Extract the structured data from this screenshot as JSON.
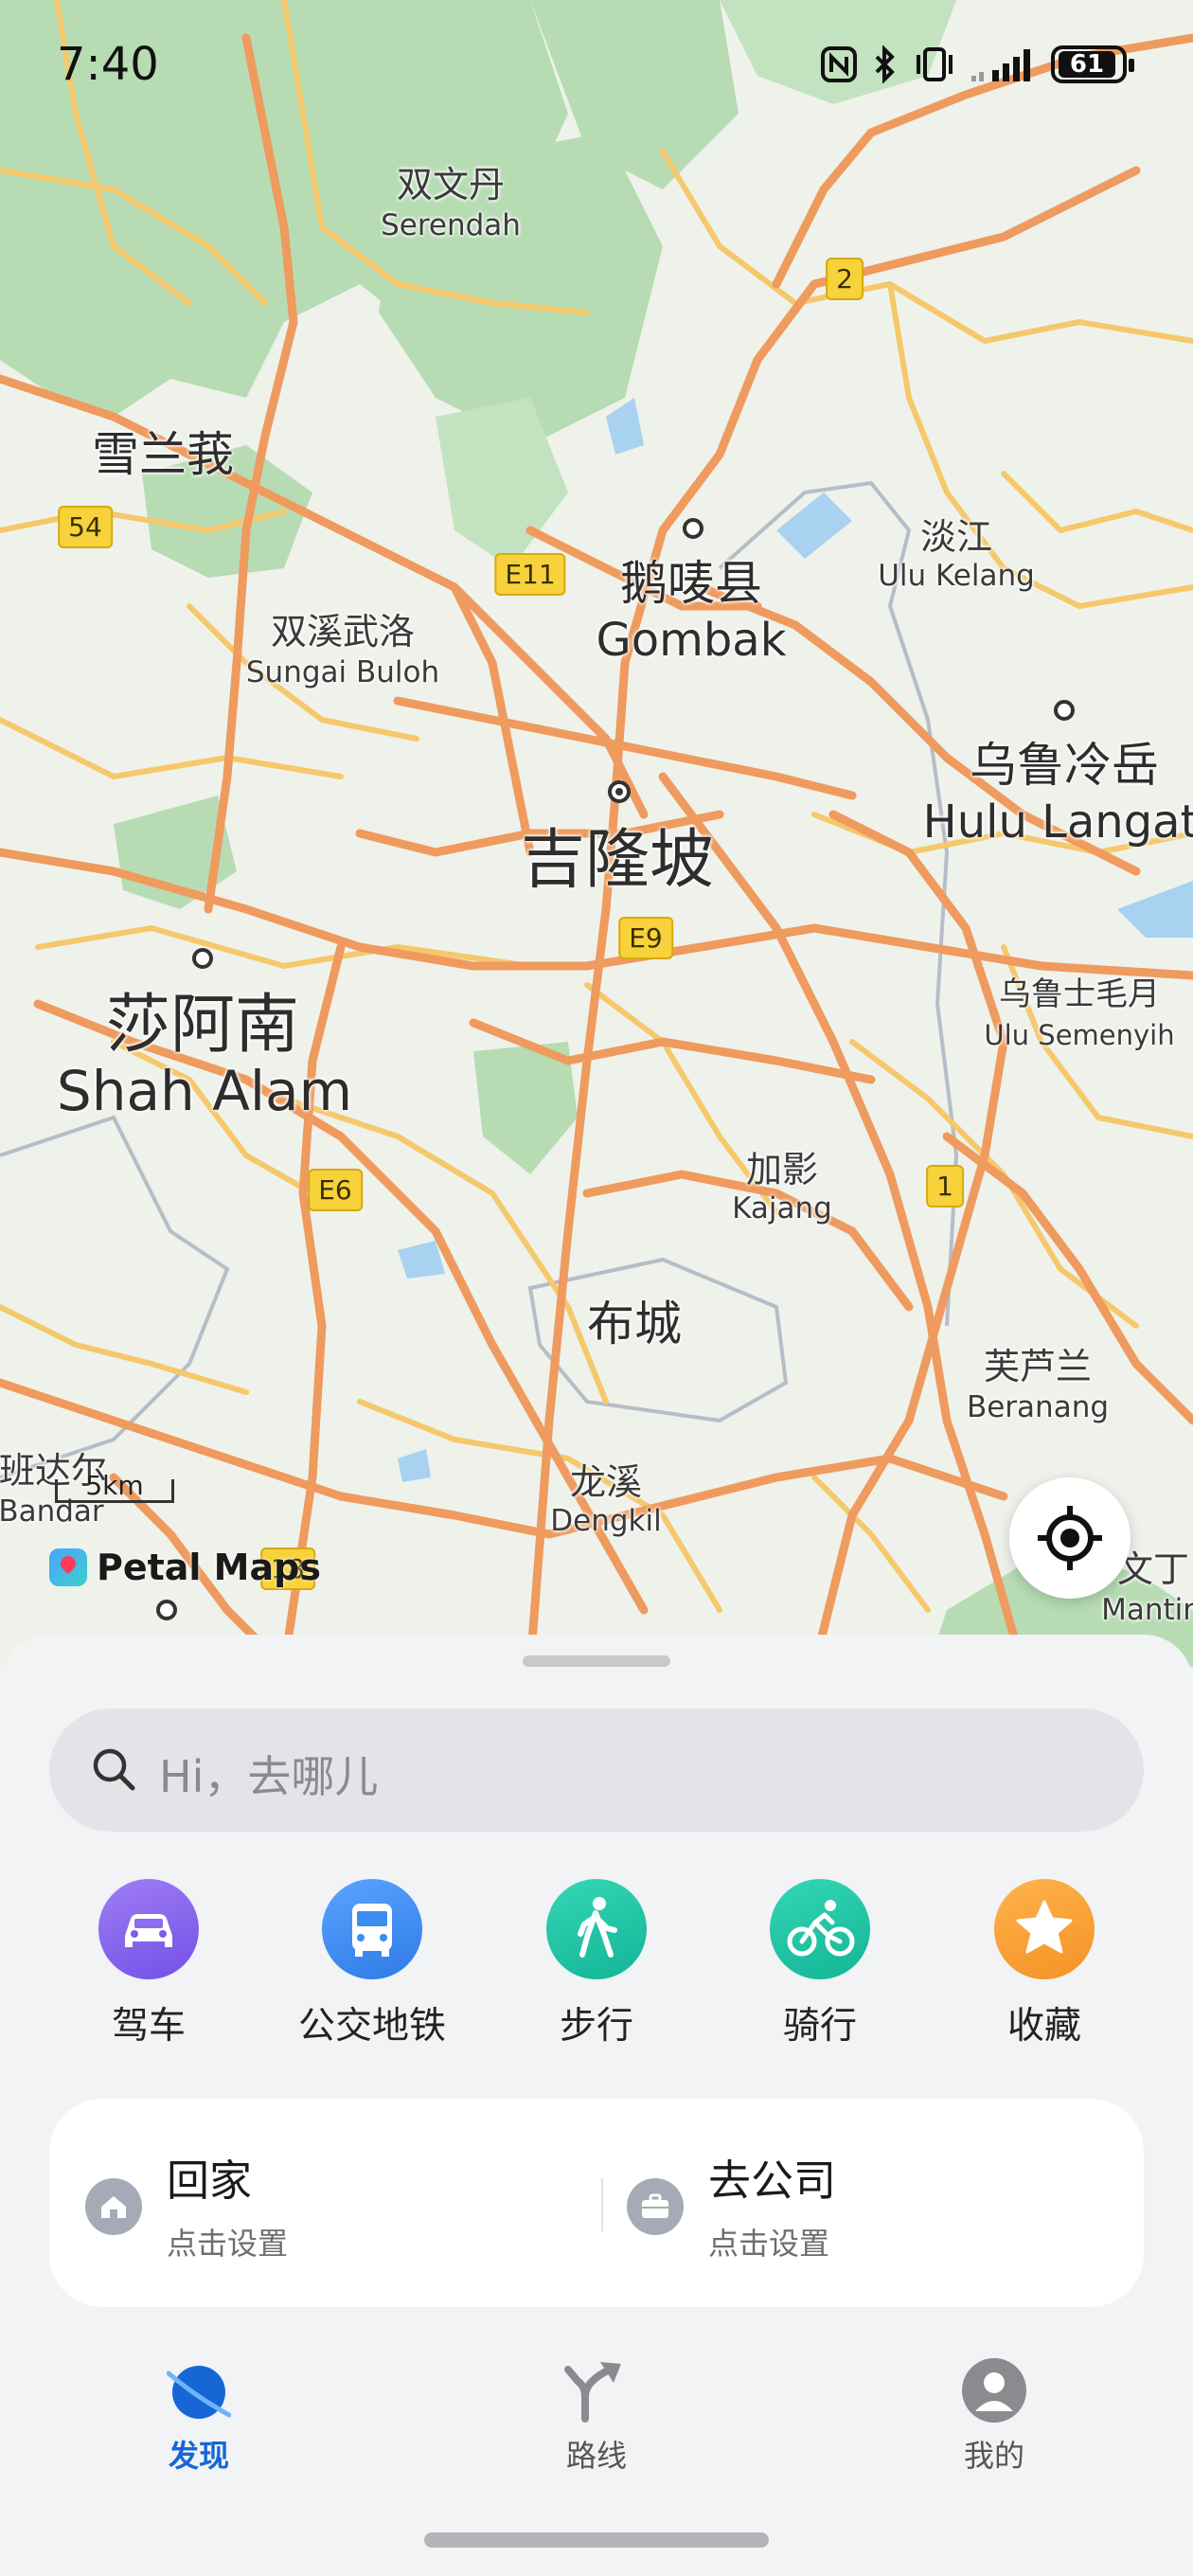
{
  "status_bar": {
    "time": "7:40",
    "battery": "61",
    "icons": [
      "nfc-icon",
      "bluetooth-icon",
      "vibrate-icon",
      "signal-icon",
      "battery-icon"
    ]
  },
  "map": {
    "labels": {
      "serendah_zh": "双文丹",
      "serendah_en": "Serendah",
      "selangor_zh": "雪兰莪",
      "gombak_zh": "鹅唛县",
      "gombak_en": "Gombak",
      "ulu_kelang_zh": "淡江",
      "ulu_kelang_en": "Ulu Kelang",
      "sungai_buloh_zh": "双溪武洛",
      "sungai_buloh_en": "Sungai Buloh",
      "kl_zh": "吉隆坡",
      "hulu_langat_zh": "乌鲁冷岳",
      "hulu_langat_en": "Hulu Langat",
      "shah_alam_zh": "莎阿南",
      "shah_alam_en": "Shah Alam",
      "semenyih_zh": "乌鲁士毛月",
      "semenyih_en": "Ulu Semenyih",
      "kajang_zh": "加影",
      "kajang_en": "Kajang",
      "putrajaya_zh": "布城",
      "beranang_zh": "芙芦兰",
      "beranang_en": "Beranang",
      "banting_zh": "班达尔",
      "banting_en": "Bandar",
      "dengkil_zh": "龙溪",
      "dengkil_en": "Dengkil",
      "mantin_zh": "文丁",
      "mantin_en": "Mantin"
    },
    "shields": {
      "r2": "2",
      "r54": "54",
      "e11": "E11",
      "e9": "E9",
      "e6": "E6",
      "r1": "1",
      "r18": "18"
    },
    "scale": "5km",
    "logo": "Petal Maps"
  },
  "sheet": {
    "search_placeholder": "Hi，去哪儿",
    "modes": [
      {
        "label": "驾车",
        "icon": "car-icon",
        "color": "#8a63ef"
      },
      {
        "label": "公交地铁",
        "icon": "bus-icon",
        "color": "#3d8cf2"
      },
      {
        "label": "步行",
        "icon": "walk-icon",
        "color": "#1ec2a5"
      },
      {
        "label": "骑行",
        "icon": "bike-icon",
        "color": "#1ec2a5"
      },
      {
        "label": "收藏",
        "icon": "star-icon",
        "color": "#f7a33a"
      }
    ],
    "home": {
      "title": "回家",
      "subtitle": "点击设置"
    },
    "work": {
      "title": "去公司",
      "subtitle": "点击设置"
    }
  },
  "nav": {
    "discover": "发现",
    "route": "路线",
    "mine": "我的",
    "active_color": "#1766d6"
  }
}
